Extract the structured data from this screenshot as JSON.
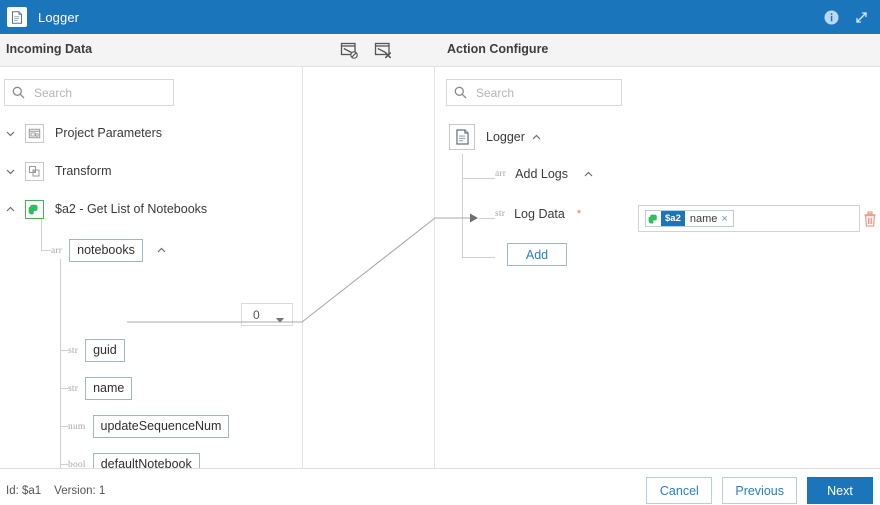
{
  "window": {
    "title": "Logger",
    "app_icon": "document-icon",
    "info_icon": "info-circle-icon",
    "expand_icon": "expand-diagonal-icon",
    "header_color": "#1b75bb"
  },
  "subheader": {
    "incoming_label": "Incoming Data",
    "action_label": "Action Configure",
    "map_icons": [
      {
        "name": "hide-mappings-icon"
      },
      {
        "name": "delete-mappings-icon"
      }
    ]
  },
  "incoming": {
    "search": {
      "placeholder": "Search",
      "value": ""
    },
    "tree": [
      {
        "label": "Project Parameters",
        "icon": "project-parameters-icon",
        "expanded": false
      },
      {
        "label": "Transform",
        "icon": "transform-icon",
        "expanded": false
      },
      {
        "label": "$a2 - Get List of Notebooks",
        "icon": "evernote-icon",
        "expanded": true
      }
    ],
    "array_node": {
      "type": "arr",
      "label": "notebooks",
      "index_value": "0"
    },
    "fields": [
      {
        "type": "str",
        "label": "guid"
      },
      {
        "type": "str",
        "label": "name"
      },
      {
        "type": "num",
        "label": "updateSequenceNum"
      },
      {
        "type": "bool",
        "label": "defaultNotebook"
      }
    ]
  },
  "action": {
    "search": {
      "placeholder": "Search",
      "value": ""
    },
    "root": {
      "label": "Logger",
      "icon": "document-icon",
      "expanded": true
    },
    "group": {
      "type": "arr",
      "label": "Add Logs",
      "expanded": true
    },
    "field": {
      "type": "str",
      "label": "Log Data",
      "required": true,
      "required_mark": "*"
    },
    "add_button": "Add",
    "value_chip": {
      "icon": "evernote-icon",
      "badge": "$a2",
      "name": "name",
      "remove": "×"
    },
    "delete_icon": "trash-icon"
  },
  "footer": {
    "id_label": "Id: $a1",
    "version_label": "Version: 1",
    "cancel": "Cancel",
    "previous": "Previous",
    "next": "Next"
  }
}
